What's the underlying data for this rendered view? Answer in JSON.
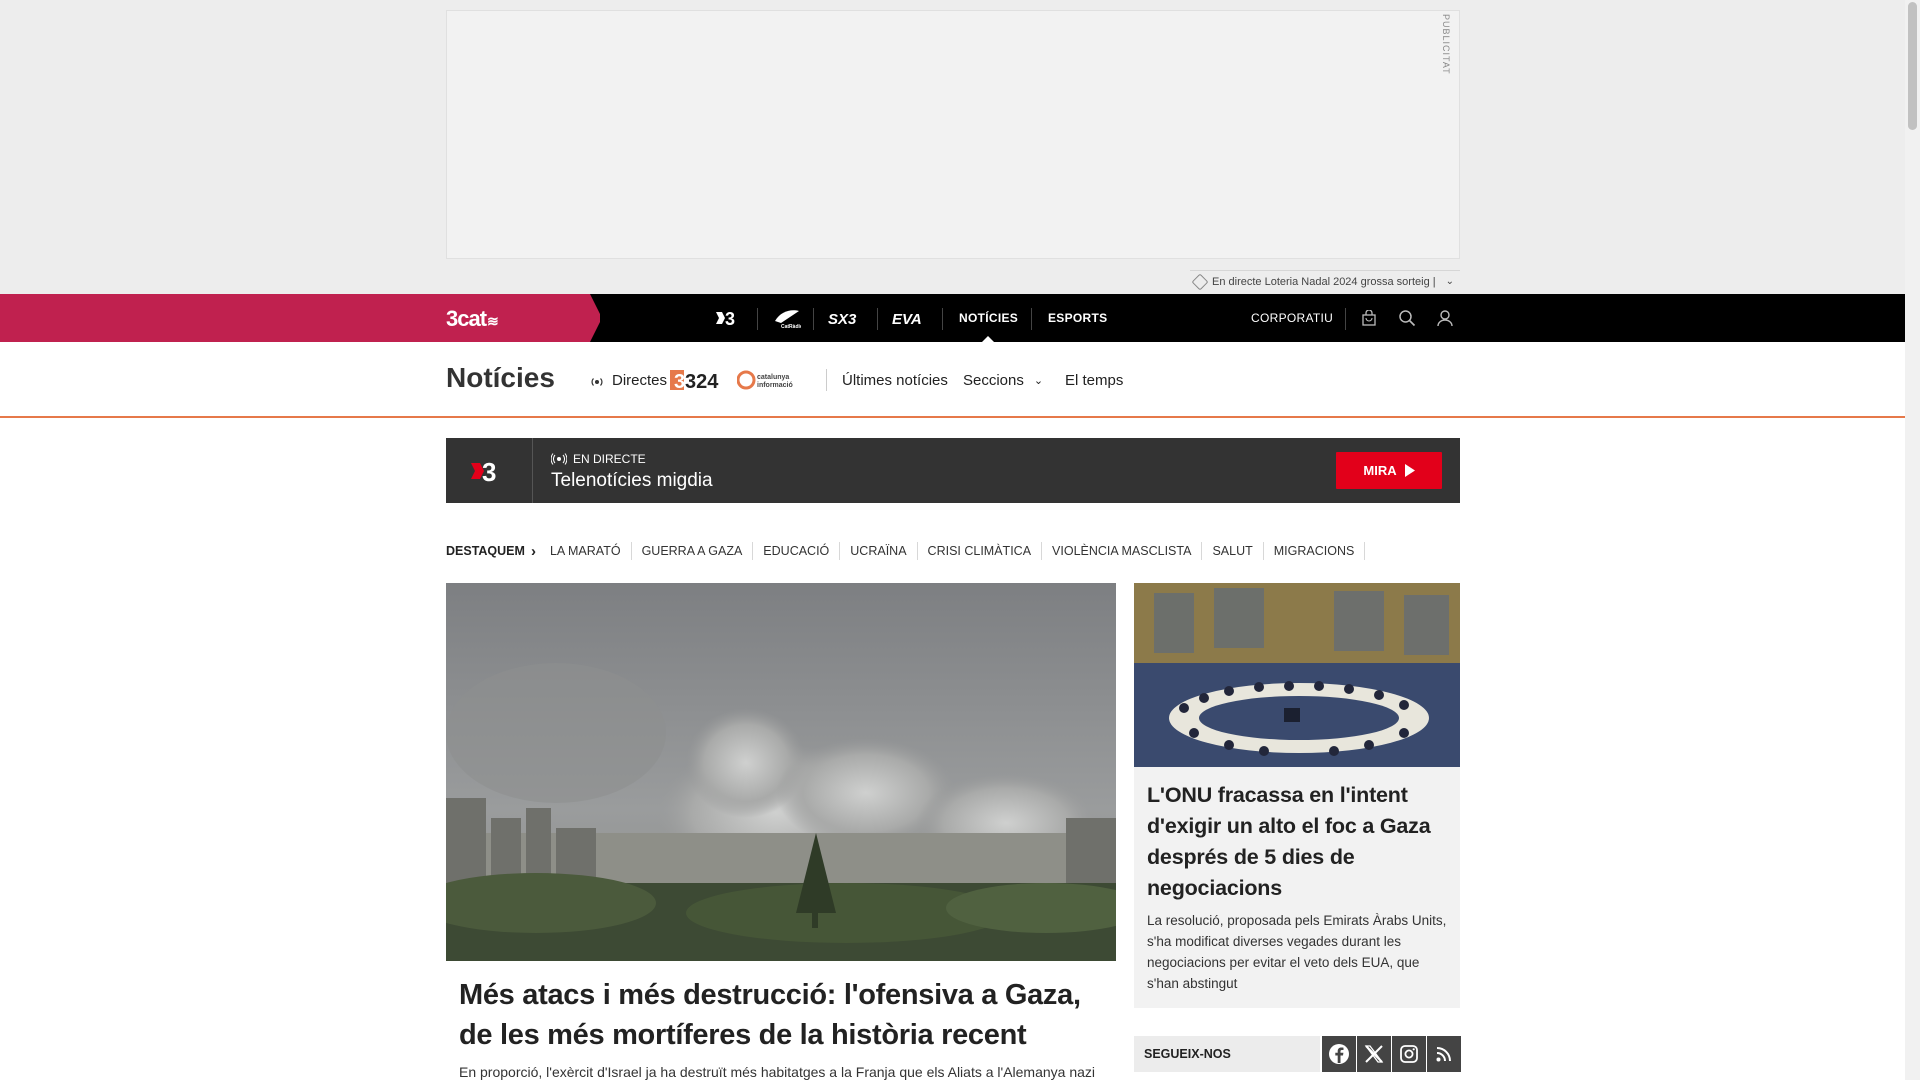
{
  "ad": {
    "label": "PUBLICITAT",
    "ticker_text": "En directe Loteria Nadal 2024 grossa sorteig |"
  },
  "topnav": {
    "brand": "3cat",
    "channels": [
      {
        "name": "3-channel-logo",
        "text": "3"
      },
      {
        "name": "catradio-logo",
        "text": "CatRàdio"
      },
      {
        "name": "sx3-logo",
        "text": "SX3"
      },
      {
        "name": "eva-logo",
        "text": "EVA"
      }
    ],
    "links": [
      "NOTÍCIES",
      "ESPORTS"
    ],
    "corporate": "CORPORATIU",
    "icons": [
      "shopping-bag-icon",
      "search-icon",
      "user-icon"
    ]
  },
  "section": {
    "title": "Notícies",
    "directes": "Directes",
    "logo_324": "324",
    "logo_catinfo": "catalunya informació",
    "items": [
      "Últimes notícies",
      "Seccions",
      "El temps"
    ]
  },
  "live": {
    "tag": "EN DIRECTE",
    "title": "Telenotícies migdia",
    "button": "MIRA"
  },
  "destaquem": {
    "label": "DESTAQUEM",
    "items": [
      "LA MARATÓ",
      "GUERRA A GAZA",
      "EDUCACIÓ",
      "UCRAÏNA",
      "CRISI CLIMÀTICA",
      "VIOLÈNCIA MASCLISTA",
      "SALUT",
      "MIGRACIONS"
    ]
  },
  "main_story": {
    "title": "Més atacs i més destrucció: l'ofensiva a Gaza, de les més mortíferes de la història recent",
    "lead": "En proporció, l'exèrcit d'Israel ja ha destruït més habitatges a la Franja que els Aliats a l'Alemanya nazi"
  },
  "side_story": {
    "title": "L'ONU fracassa en l'intent d'exigir un alto el foc a Gaza després de 5 dies de negociacions",
    "lead": "La resolució, proposada pels Emirats Àrabs Units, s'ha modificat diverses vegades durant les negociacions per evitar el veto dels EUA, que s'han abstingut"
  },
  "follow": {
    "label": "SEGUEIX-NOS",
    "networks": [
      "facebook-icon",
      "x-icon",
      "instagram-icon",
      "rss-icon"
    ]
  },
  "colors": {
    "brand_band": "#c0214f",
    "nav_bg": "#000000",
    "section_rule": "#e6794a",
    "live_bg": "#333333",
    "mira_red": "#e2001a"
  }
}
